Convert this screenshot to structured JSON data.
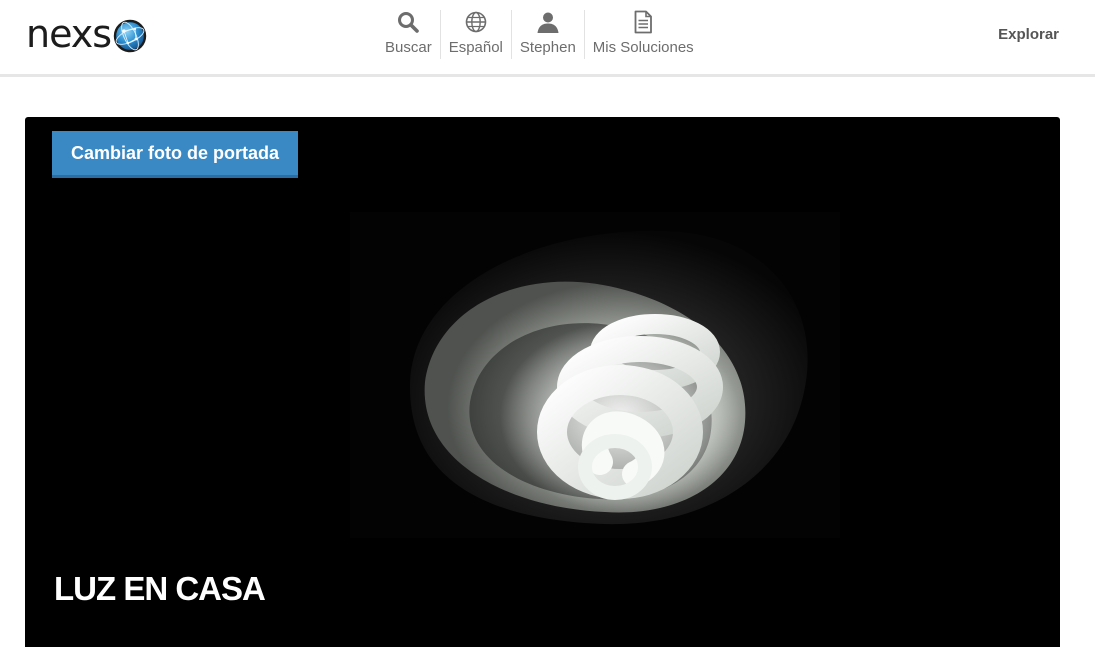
{
  "header": {
    "logo_text": "nexs",
    "nav": [
      {
        "label": "Buscar",
        "icon": "search-icon"
      },
      {
        "label": "Español",
        "icon": "globe-icon"
      },
      {
        "label": "Stephen",
        "icon": "user-icon"
      },
      {
        "label": "Mis Soluciones",
        "icon": "document-icon"
      }
    ],
    "explore_label": "Explorar"
  },
  "cover": {
    "change_button_label": "Cambiar foto de portada",
    "title": "LUZ EN CASA",
    "photo_subject": "cfl-bulb-in-lamp-shade"
  },
  "colors": {
    "accent": "#3a88c4",
    "nav_text": "#6d6d6d",
    "cover_bg": "#000000"
  }
}
